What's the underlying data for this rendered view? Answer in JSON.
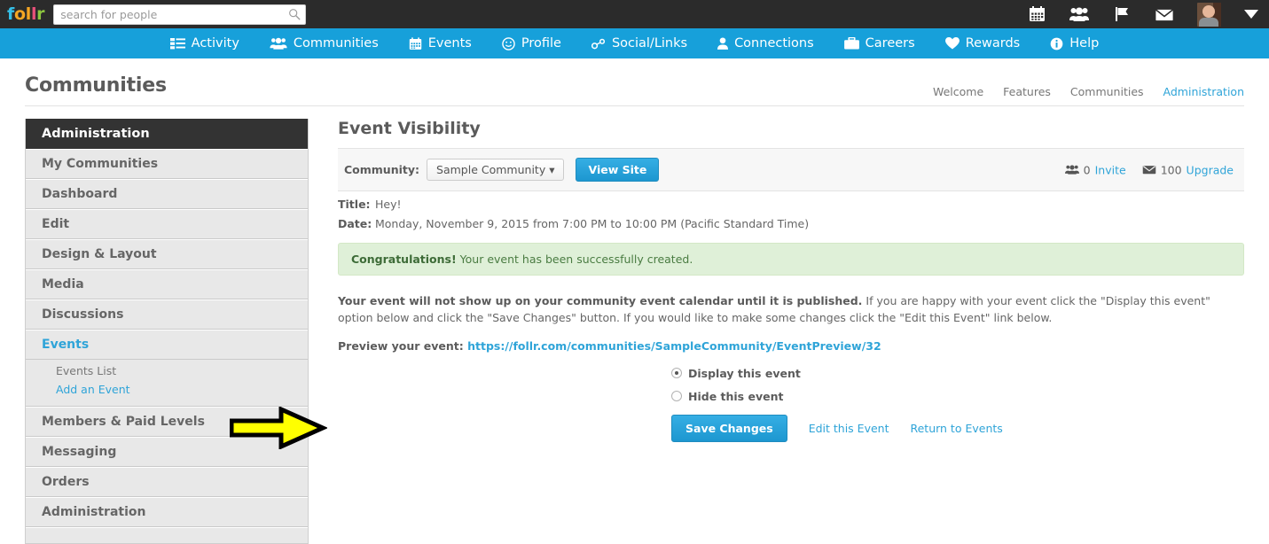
{
  "topbar": {
    "logo_letters": [
      {
        "char": "f",
        "color": "#35c0e8"
      },
      {
        "char": "o",
        "color": "#f5a623"
      },
      {
        "char": "l",
        "color": "#f5a623"
      },
      {
        "char": "l",
        "color": "#e8507a"
      },
      {
        "char": "r",
        "color": "#8dc63f"
      }
    ],
    "search_placeholder": "search for people",
    "search_value": "",
    "search_icon": "search-icon",
    "icons": [
      {
        "name": "calendar-icon",
        "label": "Calendar"
      },
      {
        "name": "people-icon",
        "label": "People"
      },
      {
        "name": "flag-icon",
        "label": "Notifications"
      },
      {
        "name": "envelope-icon",
        "label": "Messages"
      }
    ],
    "avatar_name": "avatar",
    "caret_name": "account-menu-caret"
  },
  "mainnav": {
    "background": "#17a0da",
    "items": [
      {
        "label": "Activity",
        "icon": "list-icon"
      },
      {
        "label": "Communities",
        "icon": "people-icon"
      },
      {
        "label": "Events",
        "icon": "calendar-icon"
      },
      {
        "label": "Profile",
        "icon": "smiley-icon"
      },
      {
        "label": "Social/Links",
        "icon": "link-icon"
      },
      {
        "label": "Connections",
        "icon": "user-icon"
      },
      {
        "label": "Careers",
        "icon": "briefcase-icon"
      },
      {
        "label": "Rewards",
        "icon": "heart-icon"
      },
      {
        "label": "Help",
        "icon": "info-icon"
      }
    ]
  },
  "page": {
    "title": "Communities",
    "subnav": [
      {
        "label": "Welcome",
        "active": false
      },
      {
        "label": "Features",
        "active": false
      },
      {
        "label": "Communities",
        "active": false
      },
      {
        "label": "Administration",
        "active": true
      }
    ]
  },
  "sidebar": {
    "header": "Administration",
    "items": [
      {
        "label": "My Communities",
        "active": false
      },
      {
        "label": "Dashboard",
        "active": false
      },
      {
        "label": "Edit",
        "active": false
      },
      {
        "label": "Design & Layout",
        "active": false
      },
      {
        "label": "Media",
        "active": false
      },
      {
        "label": "Discussions",
        "active": false
      },
      {
        "label": "Events",
        "active": true
      },
      {
        "label": "Members & Paid Levels",
        "active": false
      },
      {
        "label": "Messaging",
        "active": false
      },
      {
        "label": "Orders",
        "active": false
      },
      {
        "label": "Administration",
        "active": false
      }
    ],
    "events_sub": [
      {
        "label": "Events List",
        "link": false
      },
      {
        "label": "Add an Event",
        "link": true
      }
    ]
  },
  "main": {
    "title": "Event Visibility",
    "toolbar": {
      "community_label": "Community:",
      "community_selected": "Sample Community",
      "view_site_label": "View Site",
      "invite_count": "0",
      "invite_label": "Invite",
      "upgrade_count": "100",
      "upgrade_label": "Upgrade"
    },
    "event": {
      "title_label": "Title:",
      "title_value": "Hey!",
      "date_label": "Date:",
      "date_value": "Monday, November 9, 2015 from 7:00 PM to 10:00 PM (Pacific Standard Time)"
    },
    "alert": {
      "strong": "Congratulations!",
      "text": " Your event has been successfully created.",
      "background": "#dff0d8"
    },
    "body": {
      "strong": "Your event will not show up on your community event calendar until it is published.",
      "rest": " If you are happy with your event click the \"Display this event\" option below and click the \"Save Changes\" button. If you would like to make some changes click the \"Edit this Event\" link below."
    },
    "preview": {
      "label": "Preview your event: ",
      "url": "https://follr.com/communities/SampleCommunity/EventPreview/32"
    },
    "visibility": {
      "options": [
        {
          "label": "Display this event",
          "selected": true
        },
        {
          "label": "Hide this event",
          "selected": false
        }
      ]
    },
    "actions": {
      "save_label": "Save Changes",
      "edit_label": "Edit this Event",
      "return_label": "Return to Events",
      "annotation": "yellow-arrow-pointing-at-save-changes"
    }
  },
  "colors": {
    "brand_blue": "#17a0da",
    "link_blue": "#2fa4d8",
    "topbar_dark": "#2b2b2b",
    "sidebar_header_dark": "#333333",
    "annotation_yellow": "#ffff00"
  }
}
